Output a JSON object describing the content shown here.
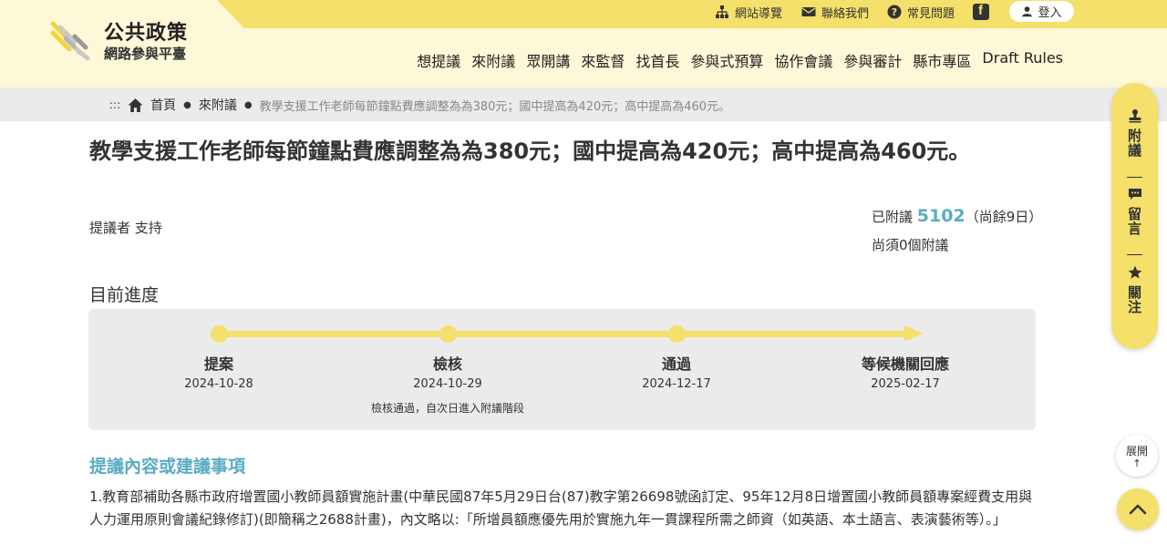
{
  "site": {
    "title": "公共政策",
    "subtitle": "網路參與平臺"
  },
  "utility": {
    "sitemap": "網站導覽",
    "contact": "聯絡我們",
    "faq": "常見問題",
    "login": "登入"
  },
  "nav": [
    "想提議",
    "來附議",
    "眾開講",
    "來監督",
    "找首長",
    "參與式預算",
    "協作會議",
    "參與審計",
    "縣市專區",
    "Draft Rules"
  ],
  "breadcrumb": {
    "prefix": ":::",
    "home": "首頁",
    "section": "來附議",
    "current": "教學支援工作老師每節鐘點費應調整為為380元；國中提高為420元；高中提高為460元。"
  },
  "proposal": {
    "title": "教學支援工作老師每節鐘點費應調整為為380元；國中提高為420元；高中提高為460元。",
    "proposer": "提議者 支持",
    "signed_label": "已附議",
    "signed_count": "5102",
    "remaining": "（尚餘9日）",
    "needed": "尚須0個附議"
  },
  "progress": {
    "heading": "目前進度",
    "stages": [
      {
        "name": "提案",
        "date": "2024-10-28",
        "note": ""
      },
      {
        "name": "檢核",
        "date": "2024-10-29",
        "note": "檢核通過，自次日進入附議階段"
      },
      {
        "name": "通過",
        "date": "2024-12-17",
        "note": ""
      },
      {
        "name": "等候機關回應",
        "date": "2025-02-17",
        "note": ""
      }
    ]
  },
  "content": {
    "heading": "提議內容或建議事項",
    "body": "1.教育部補助各縣市政府增置國小教師員額實施計畫(中華民國87年5月29日台(87)教字第26698號函訂定、95年12月8日增置國小教師員額專案經費支用與人力運用原則會議紀錄修訂)(即簡稱之2688計畫)，內文略以:「所增員額應優先用於實施九年一貫課程所需之師資（如英語、本土語言、表演藝術等）。」"
  },
  "side_tools": {
    "sign": "附議",
    "comment": "留言",
    "follow": "關注",
    "expand": "展開",
    "expand_arrow": "↑"
  },
  "colors": {
    "brand_yellow": "#f4e06a",
    "header_bg": "#fdf8d8",
    "accent_blue": "#5aacc4",
    "panel_gray": "#ebebeb"
  }
}
